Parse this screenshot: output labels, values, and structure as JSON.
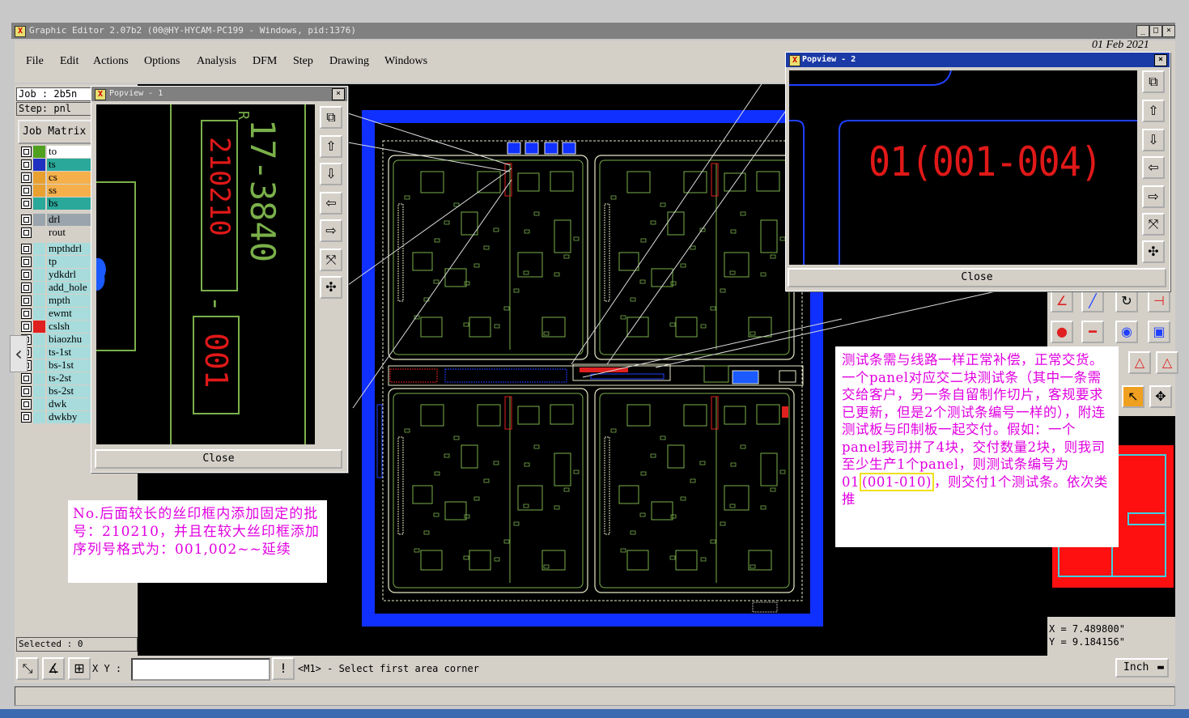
{
  "window": {
    "title": "Graphic Editor 2.07b2 (00@HY-HYCAM-PC199 - Windows, pid:1376)",
    "controls": [
      "_",
      "□",
      "×"
    ]
  },
  "menu": [
    "File",
    "Edit",
    "Actions",
    "Options",
    "Analysis",
    "DFM",
    "Step",
    "Drawing",
    "Windows"
  ],
  "left_panel": {
    "job": "Job : 2b5n",
    "step": "Step: pnl",
    "job_matrix": "Job Matrix",
    "selected": "Selected : 0",
    "layers": [
      {
        "name": "to",
        "color": "#50a020",
        "bg": "#ffffff"
      },
      {
        "name": "ts",
        "color": "#2030c0",
        "bg": "#2aa89a"
      },
      {
        "name": "cs",
        "color": "#e8a030",
        "bg": "#f5b04c"
      },
      {
        "name": "ss",
        "color": "#e8a030",
        "bg": "#f5b04c"
      },
      {
        "name": "bs",
        "color": "#2aa89a",
        "bg": "#2aa89a"
      },
      {
        "name": "drl",
        "color": "#9aa4ac",
        "bg": "#9aa4ac"
      },
      {
        "name": "rout",
        "color": "#d4d0c8",
        "bg": "#d4d0c8"
      },
      {
        "name": "mpthdrl",
        "color": "#a8dcdc",
        "bg": "#a8dcdc"
      },
      {
        "name": "tp",
        "color": "#a8dcdc",
        "bg": "#a8dcdc"
      },
      {
        "name": "ydkdrl",
        "color": "#a8dcdc",
        "bg": "#a8dcdc"
      },
      {
        "name": "add_hole",
        "color": "#a8dcdc",
        "bg": "#a8dcdc"
      },
      {
        "name": "mpth",
        "color": "#a8dcdc",
        "bg": "#a8dcdc"
      },
      {
        "name": "ewmt",
        "color": "#a8dcdc",
        "bg": "#a8dcdc"
      },
      {
        "name": "cslsh",
        "color": "#e02020",
        "bg": "#a8dcdc"
      },
      {
        "name": "biaozhu",
        "color": "#a8dcdc",
        "bg": "#a8dcdc"
      },
      {
        "name": "ts-1st",
        "color": "#a8dcdc",
        "bg": "#a8dcdc"
      },
      {
        "name": "bs-1st",
        "color": "#a8dcdc",
        "bg": "#a8dcdc"
      },
      {
        "name": "ts-2st",
        "color": "#a8dcdc",
        "bg": "#a8dcdc"
      },
      {
        "name": "bs-2st",
        "color": "#a8dcdc",
        "bg": "#a8dcdc"
      },
      {
        "name": "dwk",
        "color": "#a8dcdc",
        "bg": "#a8dcdc"
      },
      {
        "name": "dwkby",
        "color": "#a8dcdc",
        "bg": "#a8dcdc"
      }
    ]
  },
  "popview1": {
    "title": "Popview - 1",
    "text_lot": "210210",
    "text_serial_prefix": "-",
    "text_serial": "001",
    "text_green": "17-3840",
    "close": "Close"
  },
  "popview2": {
    "title": "Popview - 2",
    "label": "01(001-004)",
    "close": "Close"
  },
  "notes": {
    "left": "No.后面较长的丝印框内添加固定的批号：210210，并且在较大丝印框添加序列号格式为：001,002~~延续",
    "right": "测试条需与线路一样正常补偿，正常交货。一个panel对应交二块测试条（其中一条需交给客户，另一条自留制作切片，客规要求已更新，但是2个测试条编号一样的），附连测试板与印制板一起交付。假如：一个panel我司拼了4块，交付数量2块，则我司至少生产1个panel，则测试条编号为01",
    "right_highlight": "(001-010)",
    "right_tail": "，则交付1个测试条。依次类推"
  },
  "right_header_partial": "01 Feb 2021",
  "coordinates": {
    "x": "X = 7.489800\"",
    "y": "Y = 9.184156\""
  },
  "status": {
    "xy_label": "X Y :",
    "xy_value": "",
    "message": "<M1> - Select first area corner",
    "units": "Inch"
  },
  "colors": {
    "panel_border": "#1030ff",
    "board_outline": "#e8e8c8",
    "circuit": "#7ab04a",
    "text_red": "#e01818",
    "note_text": "#e000e0",
    "highlight": "#f0e020"
  }
}
